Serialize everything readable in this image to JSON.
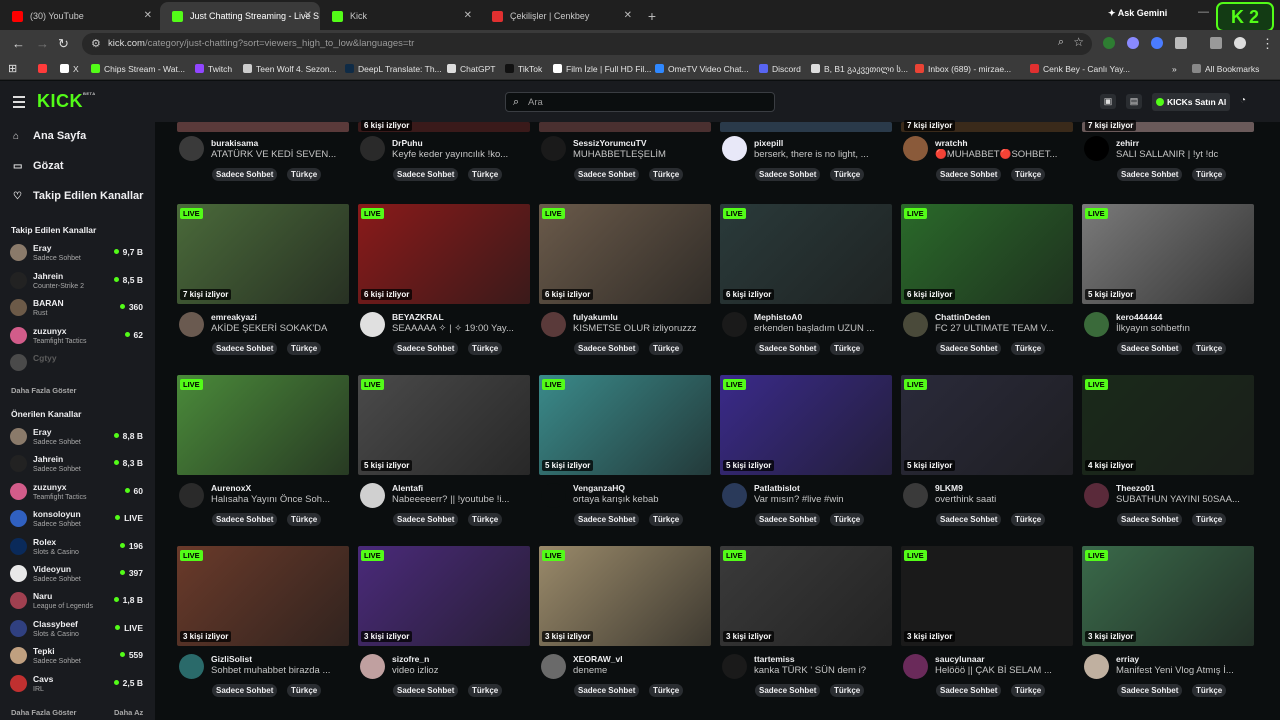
{
  "browser": {
    "tabs": [
      {
        "label": "(30) YouTube",
        "icon": "youtube-icon",
        "color": "#ff0000"
      },
      {
        "label": "Just Chatting Streaming - Live S",
        "icon": "kick-icon",
        "color": "#53fc18",
        "active": true
      },
      {
        "label": "Kick",
        "icon": "kick-icon",
        "color": "#53fc18"
      },
      {
        "label": "Çekilişler | Cenkbey",
        "icon": "cenkbey-icon",
        "color": "#e03030"
      }
    ],
    "ask_gemini": "Ask Gemini",
    "kick_badge": "K 2",
    "url_main": "kick.com",
    "url_rest": "/category/just-chatting?sort=viewers_high_to_low&languages=tr",
    "bookmarks": [
      {
        "label": "",
        "color": "#ff3b3b"
      },
      {
        "label": "X",
        "color": "#ffffff"
      },
      {
        "label": "Chips Stream - Wat...",
        "color": "#53fc18"
      },
      {
        "label": "Twitch",
        "color": "#9146ff"
      },
      {
        "label": "Teen Wolf 4. Sezon...",
        "color": "#cccccc"
      },
      {
        "label": "DeepL Translate: Th...",
        "color": "#0f2b46"
      },
      {
        "label": "ChatGPT",
        "color": "#dddddd"
      },
      {
        "label": "TikTok",
        "color": "#111111"
      },
      {
        "label": "Film İzle | Full HD Fil...",
        "color": "#ffffff"
      },
      {
        "label": "OmeTV Video Chat...",
        "color": "#2f88ff"
      },
      {
        "label": "Discord",
        "color": "#5865f2"
      },
      {
        "label": "B, B1 გაკვეთილი ს...",
        "color": "#dddddd"
      },
      {
        "label": "Inbox (689) - mirzae...",
        "color": "#ea4335"
      },
      {
        "label": "Cenk Bey - Canlı Yay...",
        "color": "#e03030"
      }
    ],
    "all_bookmarks": "All Bookmarks"
  },
  "header": {
    "logo": "KICK",
    "logo_sup": "BETA",
    "search_placeholder": "Ara",
    "buy_kicks": "KICKs Satın Al"
  },
  "sidebar": {
    "nav": [
      {
        "label": "Ana Sayfa",
        "icon": "home-icon",
        "glyph": "⌂"
      },
      {
        "label": "Gözat",
        "icon": "browse-icon",
        "glyph": "▭"
      },
      {
        "label": "Takip Edilen Kanallar",
        "icon": "heart-icon",
        "glyph": "♡"
      }
    ],
    "followed_title": "Takip Edilen Kanallar",
    "followed": [
      {
        "name": "Eray",
        "category": "Sadece Sohbet",
        "viewers": "9,7 B",
        "color": "#8a7a6a"
      },
      {
        "name": "Jahrein",
        "category": "Counter-Strike 2",
        "viewers": "8,5 B",
        "color": "#222222"
      },
      {
        "name": "BARAN",
        "category": "Rust",
        "viewers": "360",
        "color": "#6c5a48"
      },
      {
        "name": "zuzunyx",
        "category": "Teamfight Tactics",
        "viewers": "62",
        "color": "#d25c8a"
      },
      {
        "name": "Cgtyy",
        "category": "",
        "viewers": "",
        "color": "#4a4a4a",
        "offline": true
      }
    ],
    "show_more": "Daha Fazla Göster",
    "recommended_title": "Önerilen Kanallar",
    "recommended": [
      {
        "name": "Eray",
        "category": "Sadece Sohbet",
        "viewers": "8,8 B",
        "color": "#8a7a6a"
      },
      {
        "name": "Jahrein",
        "category": "Sadece Sohbet",
        "viewers": "8,3 B",
        "color": "#222222"
      },
      {
        "name": "zuzunyx",
        "category": "Teamfight Tactics",
        "viewers": "60",
        "color": "#d25c8a"
      },
      {
        "name": "konsoloyun",
        "category": "Sadece Sohbet",
        "viewers": "LIVE",
        "color": "#3060c0"
      },
      {
        "name": "Rolex",
        "category": "Slots & Casino",
        "viewers": "196",
        "color": "#0a2a5a"
      },
      {
        "name": "Videoyun",
        "category": "Sadece Sohbet",
        "viewers": "397",
        "color": "#e8e8e8"
      },
      {
        "name": "Naru",
        "category": "League of Legends",
        "viewers": "1,8 B",
        "color": "#a04050"
      },
      {
        "name": "Classybeef",
        "category": "Slots & Casino",
        "viewers": "LIVE",
        "color": "#304080"
      },
      {
        "name": "Tepki",
        "category": "Sadece Sohbet",
        "viewers": "559",
        "color": "#c0a080"
      },
      {
        "name": "Cavs",
        "category": "IRL",
        "viewers": "2,5 B",
        "color": "#c03030"
      }
    ],
    "show_more_bottom": "Daha Fazla Göster",
    "show_less": "Daha Az"
  },
  "grid": {
    "tag_chat": "Sadece Sohbet",
    "tag_lang": "Türkçe",
    "live_label": "LIVE",
    "top_row": [
      {
        "name": "burakisama",
        "title": "ATATÜRK VE KEDİ SEVEN...",
        "viewers": "",
        "thumb": "#5a3a3a",
        "avatar": "#3a3a3a"
      },
      {
        "name": "DrPuhu",
        "title": "Keyfe keder yayıncılık !ko...",
        "viewers": "6 kişi izliyor",
        "thumb": "#3a1a1a",
        "avatar": "#2a2a2a"
      },
      {
        "name": "SessizYorumcuTV",
        "title": "MUHABBETLEŞELİM",
        "viewers": "",
        "thumb": "#4a3030",
        "avatar": "#1a1a1a"
      },
      {
        "name": "pixepill",
        "title": "berserk, there is no light, ...",
        "viewers": "",
        "thumb": "#2a3a4a",
        "avatar": "#e8e8f8"
      },
      {
        "name": "wratchh",
        "title": "🔴MUHABBET🔴SOHBET...",
        "viewers": "7 kişi izliyor",
        "thumb": "#3a2a1a",
        "avatar": "#8a5a3a"
      },
      {
        "name": "zehirr",
        "title": "SALI SALLANIR | !yt !dc",
        "viewers": "7 kişi izliyor",
        "thumb": "#6a5a5a",
        "avatar": "#000000"
      }
    ],
    "rows": [
      [
        {
          "name": "emreakyazi",
          "title": "AKİDE ŞEKERİ SOKAK'DA",
          "viewers": "7 kişi izliyor",
          "thumb": "#4a6a3a",
          "avatar": "#6a5a50"
        },
        {
          "name": "BEYAZKRAL",
          "title": "SEAAAAA ✧ | ✧ 19:00 Yay...",
          "viewers": "6 kişi izliyor",
          "thumb": "#8a1a1a",
          "avatar": "#e0e0e0"
        },
        {
          "name": "fulyakumlu",
          "title": "KISMETSE OLUR izliyoruzzz",
          "viewers": "6 kişi izliyor",
          "thumb": "#6a5a4a",
          "avatar": "#5a3a3a"
        },
        {
          "name": "MephistoA0",
          "title": "erkenden başladım UZUN ...",
          "viewers": "6 kişi izliyor",
          "thumb": "#2a3a3a",
          "avatar": "#1a1a1a"
        },
        {
          "name": "ChattinDeden",
          "title": "FC 27 ULTIMATE TEAM V...",
          "viewers": "6 kişi izliyor",
          "thumb": "#2a6a2a",
          "avatar": "#4a4a3a"
        },
        {
          "name": "kero444444",
          "title": "İlkyayın sohbetfın",
          "viewers": "5 kişi izliyor",
          "thumb": "#7a7a7a",
          "avatar": "#3a6a3a"
        }
      ],
      [
        {
          "name": "AurenoxX",
          "title": "Halısaha Yayını Önce Soh...",
          "viewers": "",
          "thumb": "#4a8a3a",
          "avatar": "#2a2a2a"
        },
        {
          "name": "Alentafi",
          "title": "Nabeeeeerr? || !youtube !i...",
          "viewers": "5 kişi izliyor",
          "thumb": "#4a4a4a",
          "avatar": "#d0d0d0"
        },
        {
          "name": "VenganzaHQ",
          "title": "ortaya karışık kebab",
          "viewers": "5 kişi izliyor",
          "thumb": "#3a8a8a",
          "avatar": "#0b0e0f"
        },
        {
          "name": "Patlatbislot",
          "title": "Var mısın? #live #win",
          "viewers": "5 kişi izliyor",
          "thumb": "#3a2a8a",
          "avatar": "#2a3a5a"
        },
        {
          "name": "9LKM9",
          "title": "overthink saati",
          "viewers": "5 kişi izliyor",
          "thumb": "#2a2a3a",
          "avatar": "#3a3a3a"
        },
        {
          "name": "Theezo01",
          "title": "SUBATHUN YAYINI 50SAA...",
          "viewers": "4 kişi izliyor",
          "thumb": "#1a2a1a",
          "avatar": "#5a2a3a"
        }
      ],
      [
        {
          "name": "GizliSolist",
          "title": "Sohbet muhabbet birazda ...",
          "viewers": "3 kişi izliyor",
          "thumb": "#6a3a2a",
          "avatar": "#2a6a6a"
        },
        {
          "name": "sizofre_n",
          "title": "video izlioz",
          "viewers": "3 kişi izliyor",
          "thumb": "#4a2a7a",
          "avatar": "#c0a0a0"
        },
        {
          "name": "XEORAW_vl",
          "title": "deneme",
          "viewers": "3 kişi izliyor",
          "thumb": "#9a8a6a",
          "avatar": "#6a6a6a"
        },
        {
          "name": "ttartemiss",
          "title": "kanka TÜRK ' SÜN dem i?",
          "viewers": "3 kişi izliyor",
          "thumb": "#3a3a3a",
          "avatar": "#1a1a1a"
        },
        {
          "name": "saucylunaar",
          "title": "Helööö || ÇAK Bİ SELAM ...",
          "viewers": "3 kişi izliyor",
          "thumb": "#1a1a1a",
          "avatar": "#6a2a5a"
        },
        {
          "name": "erriay",
          "title": "Manifest Yeni Vlog Atmış İ...",
          "viewers": "3 kişi izliyor",
          "thumb": "#3a6a4a",
          "avatar": "#c0b0a0"
        }
      ]
    ]
  }
}
